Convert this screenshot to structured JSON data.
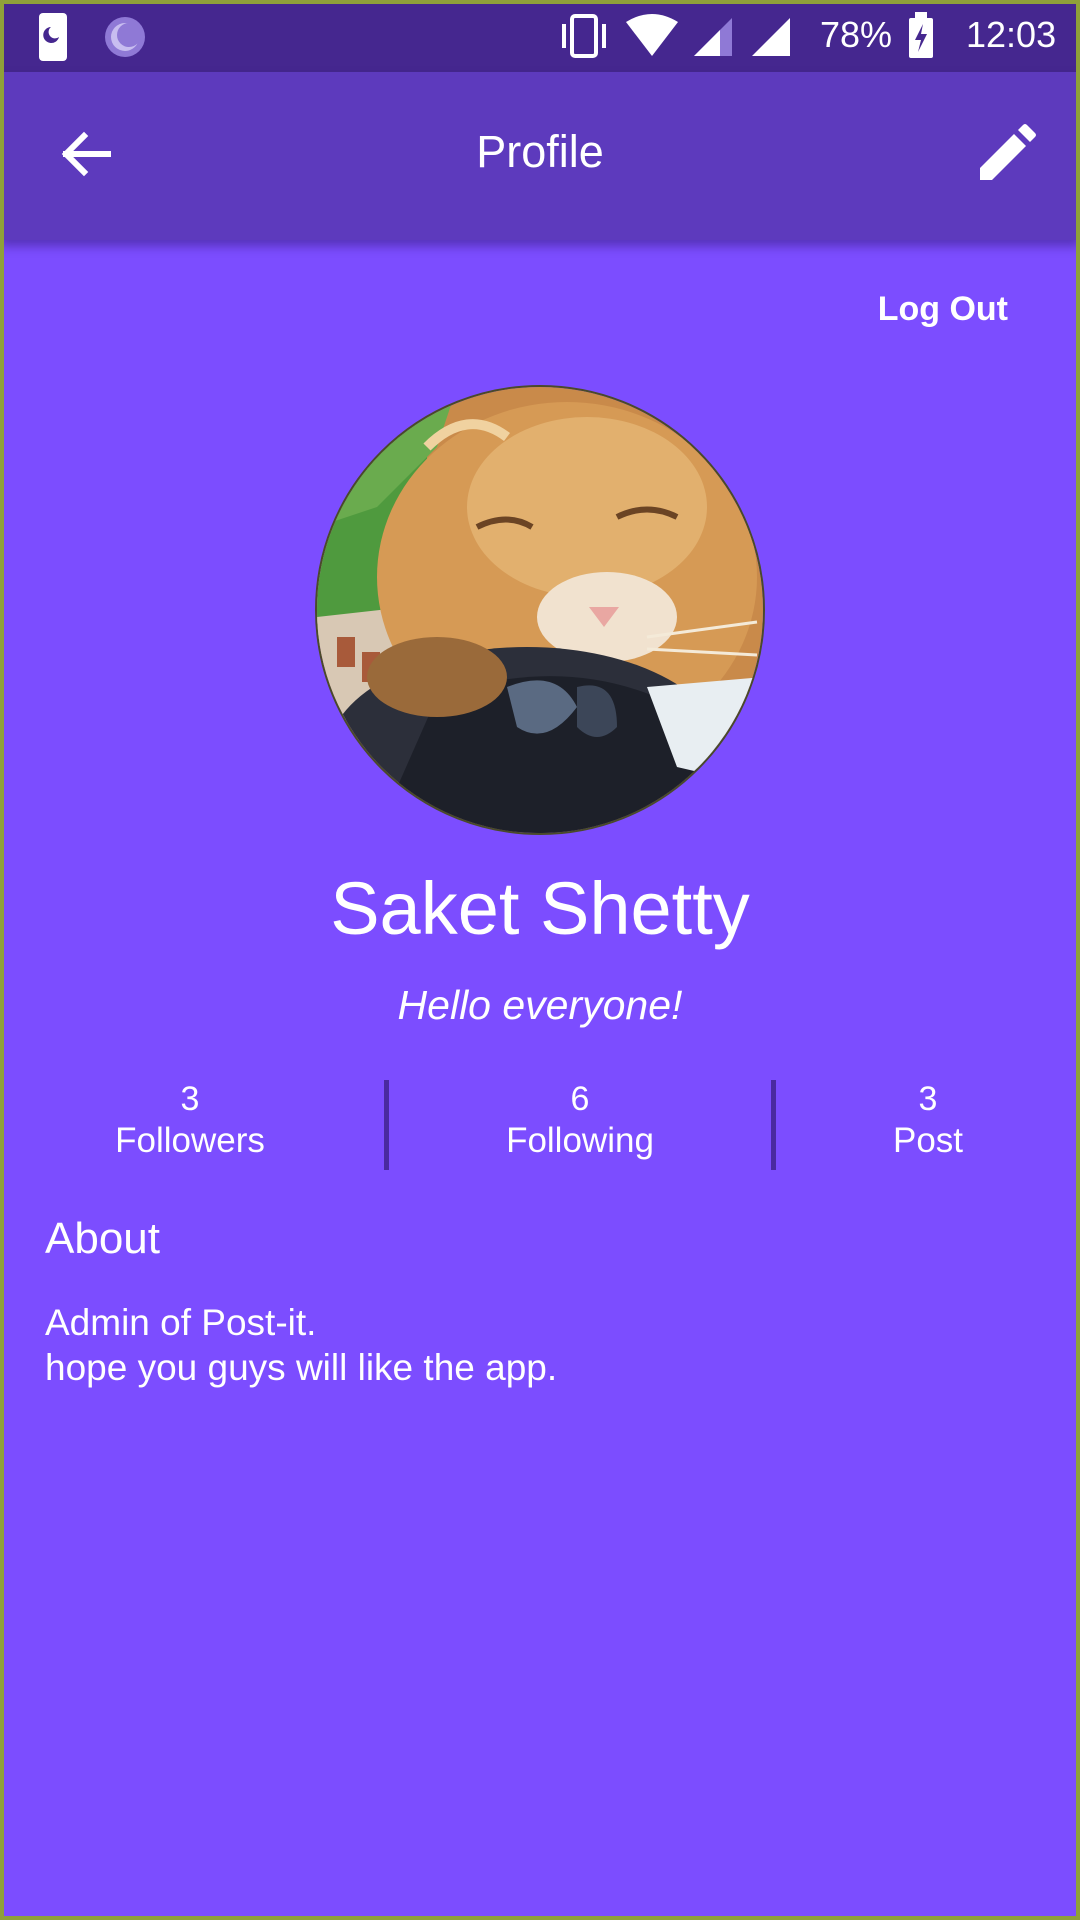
{
  "status_bar": {
    "battery": "78%",
    "time": "12:03",
    "icons": [
      "night-mode-icon",
      "sync-icon",
      "vibrate-icon",
      "wifi-icon",
      "signal-icon",
      "signal-icon",
      "battery-charging-icon"
    ]
  },
  "app_bar": {
    "title": "Profile",
    "back_icon": "arrow-back-icon",
    "edit_icon": "pencil-icon"
  },
  "actions": {
    "logout_label": "Log Out"
  },
  "profile": {
    "name": "Saket Shetty",
    "status": "Hello everyone!",
    "avatar": "cat-photo"
  },
  "stats": [
    {
      "value": "3",
      "label": "Followers"
    },
    {
      "value": "6",
      "label": "Following"
    },
    {
      "value": "3",
      "label": "Post"
    }
  ],
  "about": {
    "title": "About",
    "lines": [
      "Admin of Post-it.",
      "hope you guys will like the app."
    ]
  },
  "colors": {
    "status_bar": "#45278f",
    "app_bar": "#5d3abd",
    "background": "#7c4dff",
    "divider": "#4a2aa0",
    "text": "#ffffff"
  }
}
